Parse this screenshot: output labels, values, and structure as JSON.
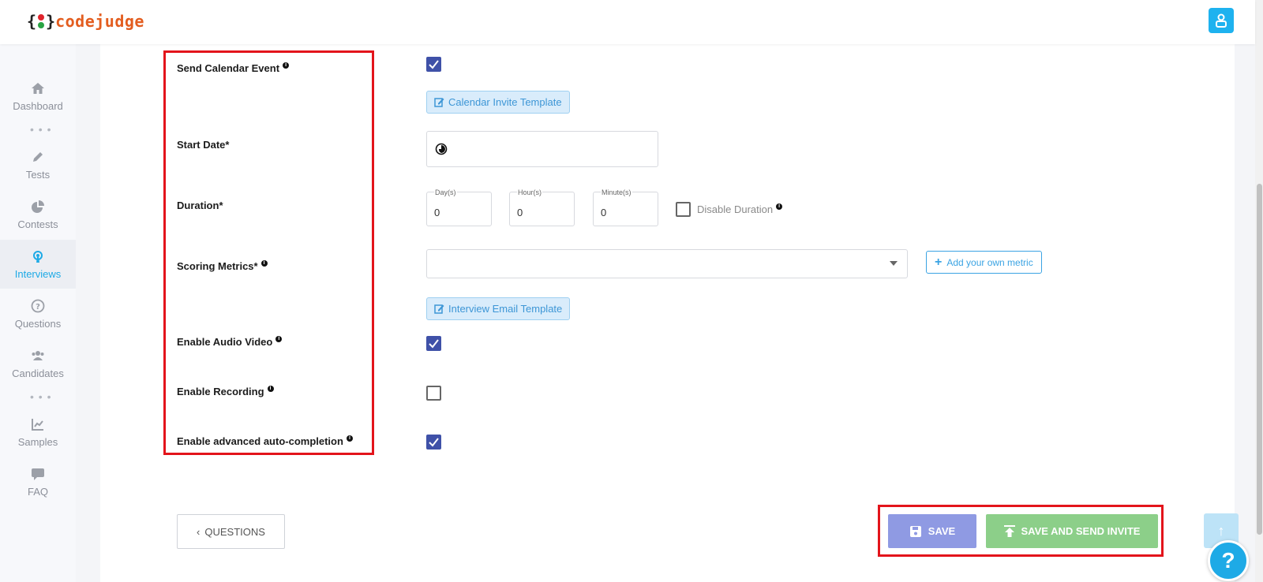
{
  "brand": {
    "brace_open": "{",
    "brace_close": "}",
    "name": "codejudge",
    "name_color": "#e35d1f",
    "dot_colors": [
      "#e0242c",
      "#29a343"
    ]
  },
  "header": {
    "user_icon": "user-icon",
    "accent": "#1eb2ef"
  },
  "sidebar": {
    "items": [
      {
        "label": "Dashboard",
        "icon": "home-icon",
        "active": false
      },
      {
        "label": "Tests",
        "icon": "pen-icon",
        "active": false
      },
      {
        "label": "Contests",
        "icon": "pie-chart-icon",
        "active": false
      },
      {
        "label": "Interviews",
        "icon": "broadcast-icon",
        "active": true
      },
      {
        "label": "Questions",
        "icon": "question-circle-icon",
        "active": false
      },
      {
        "label": "Candidates",
        "icon": "users-icon",
        "active": false
      },
      {
        "label": "Samples",
        "icon": "line-chart-icon",
        "active": false
      },
      {
        "label": "FAQ",
        "icon": "chat-icon",
        "active": false
      }
    ],
    "separator": "• • •"
  },
  "form": {
    "send_calendar_event": {
      "label": "Send Calendar Event",
      "checked": true
    },
    "calendar_template": {
      "label": "Calendar Invite Template"
    },
    "start_date": {
      "label": "Start Date*",
      "value": ""
    },
    "duration": {
      "label": "Duration*",
      "days": {
        "label": "Day(s)",
        "value": "0"
      },
      "hours": {
        "label": "Hour(s)",
        "value": "0"
      },
      "minutes": {
        "label": "Minute(s)",
        "value": "0"
      },
      "disable": {
        "label": "Disable Duration",
        "checked": false
      }
    },
    "scoring_metrics": {
      "label": "Scoring Metrics*",
      "value": "",
      "add_label": "Add your own metric"
    },
    "interview_template": {
      "label": "Interview Email Template"
    },
    "enable_audio_video": {
      "label": "Enable Audio Video",
      "checked": true
    },
    "enable_recording": {
      "label": "Enable Recording",
      "checked": false
    },
    "enable_autocompletion": {
      "label": "Enable advanced auto-completion",
      "checked": true
    }
  },
  "actions": {
    "back_label": "QUESTIONS",
    "save_label": "SAVE",
    "save_send_label": "SAVE AND SEND INVITE",
    "save_color": "#8f9ae3",
    "save_send_color": "#8ccf89",
    "help_label": "?",
    "scroll_top": "↑"
  }
}
